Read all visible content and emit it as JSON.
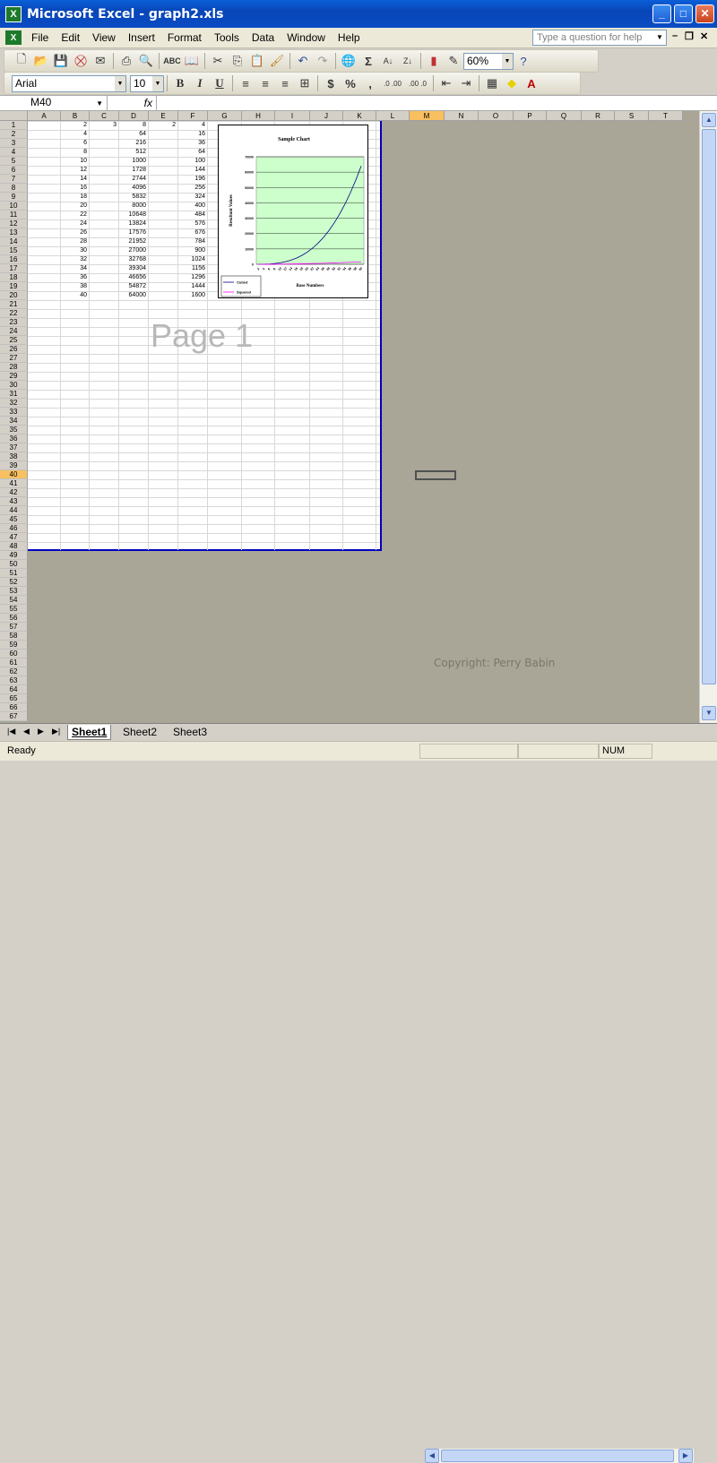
{
  "window": {
    "title": "Microsoft Excel - graph2.xls",
    "minimize": "_",
    "maximize": "□",
    "close": "✕"
  },
  "menu": [
    "File",
    "Edit",
    "View",
    "Insert",
    "Format",
    "Tools",
    "Data",
    "Window",
    "Help"
  ],
  "ask": {
    "placeholder": "Type a question for help"
  },
  "mdi": {
    "min": "–",
    "restore": "❐",
    "close": "✕"
  },
  "toolbar": {
    "zoom": "60%",
    "sigma": "Σ"
  },
  "format": {
    "font": "Arial",
    "size": "10",
    "bold": "B",
    "italic": "I",
    "underline": "U",
    "currency": "$",
    "percent": "%",
    "comma": ",",
    "inc": ".0 .00",
    "dec": ".00 .0"
  },
  "formula": {
    "namebox": "M40",
    "fx": "fx",
    "value": ""
  },
  "columns": [
    "A",
    "B",
    "C",
    "D",
    "E",
    "F",
    "G",
    "H",
    "I",
    "J",
    "K",
    "L",
    "M",
    "N",
    "O",
    "P",
    "Q",
    "R",
    "S",
    "T"
  ],
  "active": {
    "column": "M",
    "row": "40"
  },
  "cells": {
    "C1": "3",
    "E1": "2",
    "B": [
      "2",
      "4",
      "6",
      "8",
      "10",
      "12",
      "14",
      "16",
      "18",
      "20",
      "22",
      "24",
      "26",
      "28",
      "30",
      "32",
      "34",
      "36",
      "38",
      "40"
    ],
    "D": [
      "8",
      "64",
      "216",
      "512",
      "1000",
      "1728",
      "2744",
      "4096",
      "5832",
      "8000",
      "10648",
      "13824",
      "17576",
      "21952",
      "27000",
      "32768",
      "39304",
      "46656",
      "54872",
      "64000"
    ],
    "F": [
      "4",
      "16",
      "36",
      "64",
      "100",
      "144",
      "196",
      "256",
      "324",
      "400",
      "484",
      "576",
      "676",
      "784",
      "900",
      "1024",
      "1156",
      "1296",
      "1444",
      "1600"
    ]
  },
  "page_label": "Page 1",
  "chart_data": {
    "type": "line",
    "title": "Sample Chart",
    "xlabel": "Base Numbers",
    "ylabel": "Resultant Values",
    "x": [
      2,
      4,
      6,
      8,
      10,
      12,
      14,
      16,
      18,
      20,
      22,
      24,
      26,
      28,
      30,
      32,
      34,
      36,
      38,
      40
    ],
    "series": [
      {
        "name": "Cubed",
        "color": "#000080",
        "values": [
          8,
          64,
          216,
          512,
          1000,
          1728,
          2744,
          4096,
          5832,
          8000,
          10648,
          13824,
          17576,
          21952,
          27000,
          32768,
          39304,
          46656,
          54872,
          64000
        ]
      },
      {
        "name": "Squared",
        "color": "#ff00ff",
        "values": [
          4,
          16,
          36,
          64,
          100,
          144,
          196,
          256,
          324,
          400,
          484,
          576,
          676,
          784,
          900,
          1024,
          1156,
          1296,
          1444,
          1600
        ]
      }
    ],
    "ylim": [
      0,
      70000
    ],
    "yticks": [
      "70000",
      "60000",
      "50000",
      "40000",
      "30000",
      "20000",
      "10000",
      "0"
    ],
    "plot_bg": "#ccffcc",
    "legend": "bottom-left"
  },
  "copyright": "Copyright: Perry Babin",
  "sheets": [
    "Sheet1",
    "Sheet2",
    "Sheet3"
  ],
  "status": {
    "ready": "Ready",
    "num": "NUM"
  }
}
